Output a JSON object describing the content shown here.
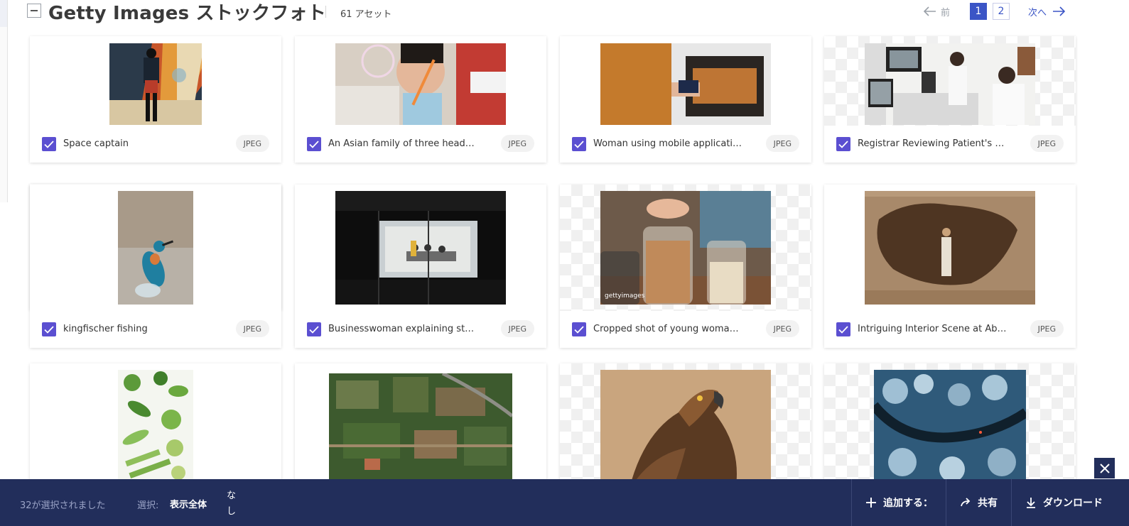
{
  "header": {
    "title": "Getty Images ストックフォト",
    "asset_count": "61 アセット",
    "pagination": {
      "prev_label": "前",
      "pages": [
        "1",
        "2"
      ],
      "current_page": "1",
      "next_label": "次へ"
    }
  },
  "cards": [
    {
      "name": "Space captain",
      "format": "JPEG",
      "selected": true,
      "icon": "image-thumbnail"
    },
    {
      "name": "An Asian family of three heads to the...",
      "format": "JPEG",
      "selected": true,
      "icon": "image-thumbnail"
    },
    {
      "name": "Woman using mobile application to...",
      "format": "JPEG",
      "selected": true,
      "icon": "image-thumbnail"
    },
    {
      "name": "Registrar Reviewing Patient's Test R...",
      "format": "JPEG",
      "selected": true,
      "icon": "image-thumbnail"
    },
    {
      "name": "kingfischer fishing",
      "format": "JPEG",
      "selected": true,
      "icon": "image-thumbnail"
    },
    {
      "name": "Businesswoman explaining strategi...",
      "format": "JPEG",
      "selected": true,
      "icon": "image-thumbnail"
    },
    {
      "name": "Cropped shot of young woman putt...",
      "format": "JPEG",
      "selected": true,
      "icon": "image-thumbnail"
    },
    {
      "name": "Intriguing Interior Scene at Abu Si...",
      "format": "JPEG",
      "selected": true,
      "icon": "image-thumbnail"
    },
    {
      "name": "",
      "format": "",
      "selected": true,
      "icon": "image-thumbnail"
    },
    {
      "name": "",
      "format": "",
      "selected": true,
      "icon": "image-thumbnail"
    },
    {
      "name": "",
      "format": "",
      "selected": true,
      "icon": "image-thumbnail"
    },
    {
      "name": "",
      "format": "",
      "selected": true,
      "icon": "image-thumbnail"
    }
  ],
  "watermark": "gettyimages",
  "bottom_bar": {
    "selected_count": "32が選択されました",
    "select_label": "選択:",
    "select_all": "表示全体",
    "select_none": "なし",
    "add_to": "追加する：",
    "share": "共有",
    "download": "ダウンロード"
  },
  "colors": {
    "accent": "#3b55c6",
    "checkbox": "#5b4fd1",
    "bottom_bar": "#222e5b"
  }
}
